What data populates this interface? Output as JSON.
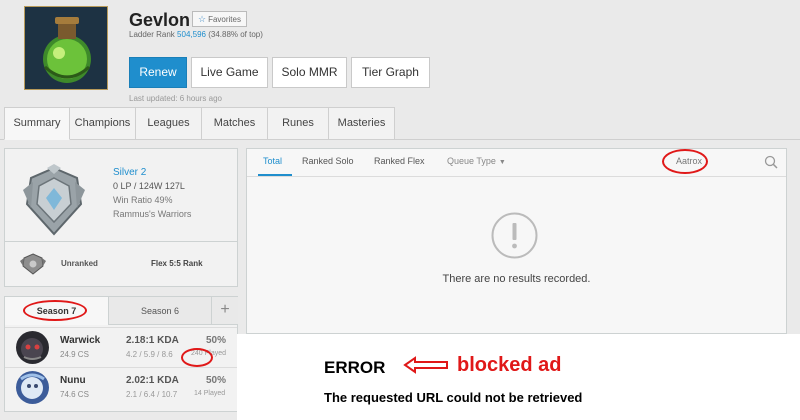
{
  "profile": {
    "name": "Gevlon",
    "favorites_label": "Favorites",
    "ladder_label": "Ladder Rank",
    "ladder_rank": "504,596",
    "ladder_pct": "(34.88% of top)",
    "last_updated": "Last updated: 6 hours ago"
  },
  "actions": {
    "renew": "Renew",
    "live_game": "Live Game",
    "solo_mmr": "Solo MMR",
    "tier_graph": "Tier Graph"
  },
  "tabs": [
    "Summary",
    "Champions",
    "Leagues",
    "Matches",
    "Runes",
    "Masteries"
  ],
  "rank": {
    "tier": "Silver 2",
    "lp_line": "0 LP / 124W 127L",
    "win_ratio": "Win Ratio 49%",
    "team": "Rammus's Warriors",
    "flex_status": "Unranked",
    "flex_label": "Flex 5:5 Rank"
  },
  "seasons": {
    "active": "Season 7",
    "other": "Season 6",
    "add": "+"
  },
  "champions": [
    {
      "name": "Warwick",
      "cs": "24.9 CS",
      "kda": "2.18:1 KDA",
      "kda_detail": "4.2 / 5.9 / 8.6",
      "winrate": "50%",
      "played": "240 Played"
    },
    {
      "name": "Nunu",
      "cs": "74.6 CS",
      "kda": "2.02:1 KDA",
      "kda_detail": "2.1 / 6.4 / 10.7",
      "winrate": "50%",
      "played": "14 Played"
    }
  ],
  "results": {
    "tabs": [
      "Total",
      "Ranked Solo",
      "Ranked Flex",
      "Queue Type"
    ],
    "champion_search_value": "Aatrox",
    "empty_message": "There are no results recorded."
  },
  "error": {
    "title": "ERROR",
    "message": "The requested URL could not be retrieved",
    "annotation": "blocked ad"
  },
  "colors": {
    "accent": "#1f8ecd",
    "annotation": "#e01818",
    "background": "#eaeaea"
  }
}
